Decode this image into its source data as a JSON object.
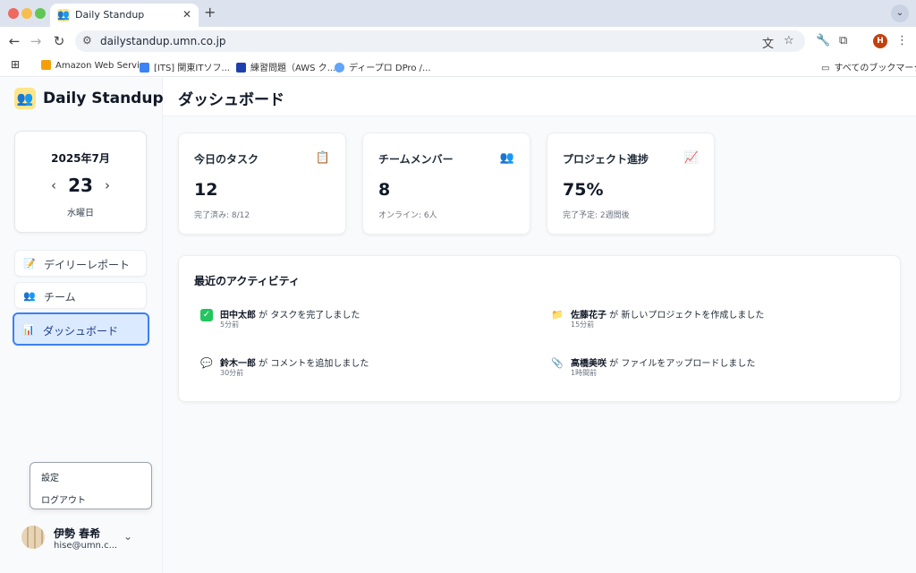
{
  "browser": {
    "tab_title": "Daily Standup",
    "url": "dailystandup.umn.co.jp",
    "profile_initial": "H",
    "bookmarks": [
      {
        "label": "Amazon Web Servi...",
        "icon": "aws-icon",
        "color": "#f59e0b"
      },
      {
        "label": "[ITS] 関東ITソフ...",
        "icon": "its-icon",
        "color": "#3b82f6"
      },
      {
        "label": "練習問題（AWS ク...",
        "icon": "practice-icon",
        "color": "#1e40af"
      },
      {
        "label": "ディープロ DPro /...",
        "icon": "dpro-icon",
        "color": "#60a5fa"
      }
    ],
    "all_bookmarks_label": "すべてのブックマーク"
  },
  "sidebar": {
    "app_name": "Daily Standup",
    "calendar": {
      "month_label": "2025年7月",
      "day": "23",
      "weekday": "水曜日"
    },
    "nav": [
      {
        "label": "デイリーレポート",
        "icon": "memo-icon"
      },
      {
        "label": "チーム",
        "icon": "team-icon"
      },
      {
        "label": "ダッシュボード",
        "icon": "chart-icon",
        "active": true
      }
    ],
    "user_menu": {
      "settings_label": "設定",
      "logout_label": "ログアウト"
    },
    "user": {
      "name": "伊勢 春希",
      "email": "hise@umn.c..."
    }
  },
  "main": {
    "page_title": "ダッシュボード",
    "stats": [
      {
        "title": "今日のタスク",
        "icon": "clipboard-icon",
        "value": "12",
        "sub": "完了済み: 8/12"
      },
      {
        "title": "チームメンバー",
        "icon": "people-icon",
        "value": "8",
        "sub": "オンライン: 6人"
      },
      {
        "title": "プロジェクト進捗",
        "icon": "trend-up-icon",
        "value": "75%",
        "sub": "完了予定: 2週間後"
      }
    ],
    "activity": {
      "title": "最近のアクティビティ",
      "items": [
        {
          "user": "田中太郎",
          "text": " が タスクを完了しました",
          "time": "5分前",
          "icon": "check-icon"
        },
        {
          "user": "佐藤花子",
          "text": " が 新しいプロジェクトを作成しました",
          "time": "15分前",
          "icon": "folder-icon"
        },
        {
          "user": "鈴木一郎",
          "text": " が コメントを追加しました",
          "time": "30分前",
          "icon": "comment-icon"
        },
        {
          "user": "高橋美咲",
          "text": " が ファイルをアップロードしました",
          "time": "1時間前",
          "icon": "paperclip-icon"
        }
      ]
    }
  }
}
